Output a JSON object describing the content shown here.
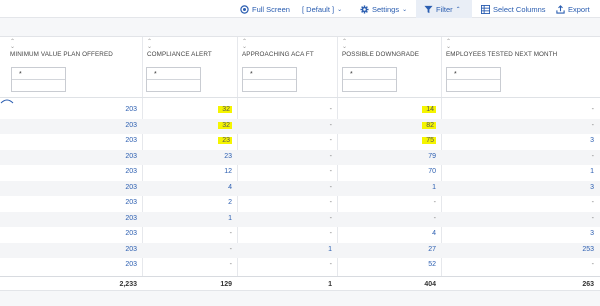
{
  "toolbar": {
    "full_screen": "Full Screen",
    "view": "[ Default ]",
    "settings": "Settings",
    "filter": "Filter",
    "select_columns": "Select Columns",
    "export": "Export"
  },
  "columns": [
    {
      "label": "MINIMUM VALUE PLAN OFFERED"
    },
    {
      "label": "COMPLIANCE ALERT"
    },
    {
      "label": "APPROACHING ACA FT"
    },
    {
      "label": "POSSIBLE DOWNGRADE"
    },
    {
      "label": "EMPLOYEES TESTED NEXT MONTH"
    }
  ],
  "filter_placeholder": "*",
  "rows": [
    [
      "203",
      "32",
      "-",
      "14",
      "-"
    ],
    [
      "203",
      "32",
      "-",
      "82",
      "-"
    ],
    [
      "203",
      "23",
      "-",
      "75",
      "3"
    ],
    [
      "203",
      "23",
      "-",
      "79",
      "-"
    ],
    [
      "203",
      "12",
      "-",
      "70",
      "1"
    ],
    [
      "203",
      "4",
      "-",
      "1",
      "3"
    ],
    [
      "203",
      "2",
      "-",
      "-",
      "-"
    ],
    [
      "203",
      "1",
      "-",
      "-",
      "-"
    ],
    [
      "203",
      "-",
      "-",
      "4",
      "3"
    ],
    [
      "203",
      "-",
      "1",
      "27",
      "253"
    ],
    [
      "203",
      "-",
      "-",
      "52",
      "-"
    ]
  ],
  "highlighted": [
    [
      0,
      1
    ],
    [
      1,
      1
    ],
    [
      2,
      1
    ],
    [
      0,
      3
    ],
    [
      1,
      3
    ],
    [
      2,
      3
    ]
  ],
  "totals": [
    "2,233",
    "129",
    "1",
    "404",
    "263"
  ],
  "colors": {
    "accent": "#2a5db0",
    "highlight": "#f5f500"
  }
}
